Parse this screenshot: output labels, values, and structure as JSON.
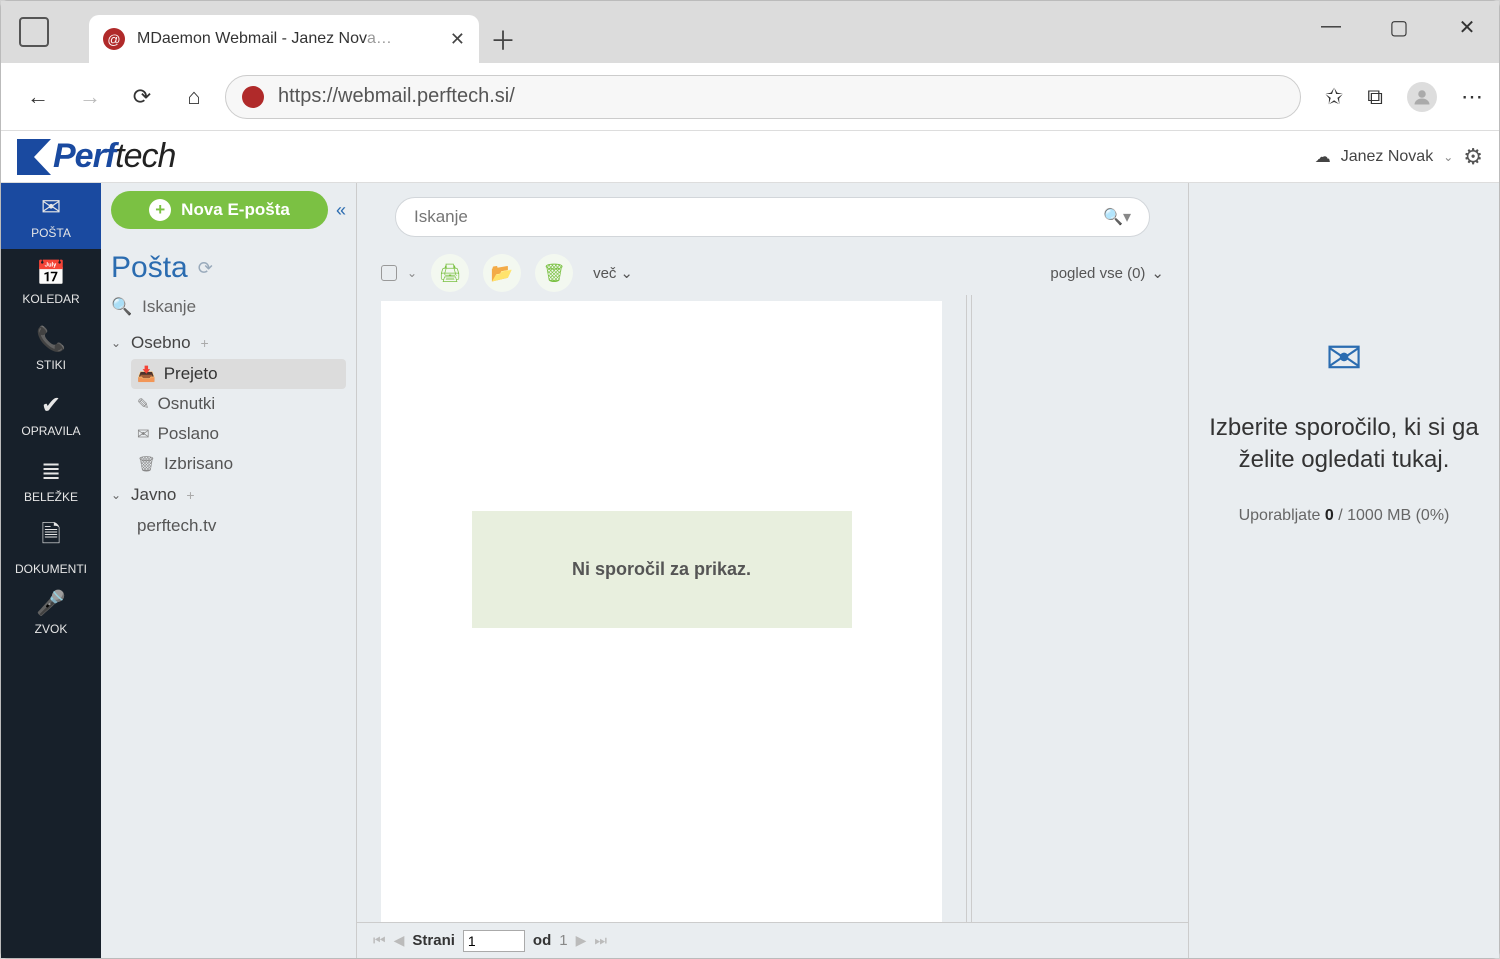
{
  "browser": {
    "tab_title": "MDaemon Webmail - Janez Nov",
    "tab_title_fade": "a…",
    "url": "https://webmail.perftech.si/"
  },
  "header": {
    "logo_bold": "Perf",
    "logo_thin": "tech",
    "user_name": "Janez Novak"
  },
  "rail": [
    {
      "icon": "✉",
      "label": "POŠTA",
      "active": true
    },
    {
      "icon": "📅",
      "label": "KOLEDAR",
      "active": false
    },
    {
      "icon": "📞",
      "label": "STIKI",
      "active": false
    },
    {
      "icon": "✔",
      "label": "OPRAVILA",
      "active": false
    },
    {
      "icon": "≣",
      "label": "BELEŽKE",
      "active": false
    },
    {
      "icon": "🗎",
      "label": "DOKUMENTI",
      "active": false
    },
    {
      "icon": "🎤",
      "label": "ZVOK",
      "active": false
    }
  ],
  "sidebar": {
    "compose_label": "Nova E-pošta",
    "section_title": "Pošta",
    "search_label": "Iskanje",
    "personal_label": "Osebno",
    "folders": [
      {
        "icon": "inbox",
        "label": "Prejeto",
        "active": true
      },
      {
        "icon": "draft",
        "label": "Osnutki",
        "active": false
      },
      {
        "icon": "sent",
        "label": "Poslano",
        "active": false
      },
      {
        "icon": "trash",
        "label": "Izbrisano",
        "active": false
      }
    ],
    "public_label": "Javno",
    "extra_label": "perftech.tv"
  },
  "list": {
    "search_placeholder": "Iskanje",
    "more_label": "več",
    "view_label": "pogled vse (0)",
    "empty_message": "Ni sporočil za prikaz.",
    "pager_label": "Strani",
    "pager_value": "1",
    "pager_of": "od",
    "pager_total": "1"
  },
  "read": {
    "prompt": "Izberite sporočilo, ki si ga želite ogledati tukaj.",
    "quota_prefix": "Uporabljate ",
    "quota_used": "0",
    "quota_suffix": " / 1000 MB (0%)"
  }
}
